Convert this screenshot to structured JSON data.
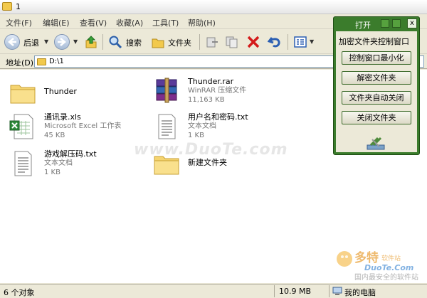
{
  "window": {
    "title": "1"
  },
  "menubar": {
    "items": [
      "文件(F)",
      "编辑(E)",
      "查看(V)",
      "收藏(A)",
      "工具(T)",
      "帮助(H)"
    ]
  },
  "toolbar": {
    "back_label": "后退",
    "search_label": "搜索",
    "folders_label": "文件夹"
  },
  "address": {
    "label": "地址(D)",
    "value": "D:\\1"
  },
  "files": [
    {
      "name": "Thunder",
      "type": "",
      "size": "",
      "icon": "folder-icon"
    },
    {
      "name": "Thunder.rar",
      "type": "WinRAR 压缩文件",
      "size": "11,163 KB",
      "icon": "winrar-archive-icon"
    },
    {
      "name": "通讯录.xls",
      "type": "Microsoft Excel 工作表",
      "size": "45 KB",
      "icon": "excel-file-icon"
    },
    {
      "name": "用户名和密码.txt",
      "type": "文本文档",
      "size": "1 KB",
      "icon": "text-file-icon"
    },
    {
      "name": "游戏解压码.txt",
      "type": "文本文档",
      "size": "1 KB",
      "icon": "text-file-icon"
    },
    {
      "name": "新建文件夹",
      "type": "",
      "size": "",
      "icon": "folder-icon"
    }
  ],
  "watermark": "www.DuoTe.com",
  "logo": {
    "brand": "多特",
    "sub": "软件站",
    "url": "DuoTe.Com",
    "slogan": "国内最安全的软件站"
  },
  "statusbar": {
    "objects": "6 个对象",
    "size": "10.9 MB",
    "location": "我的电脑"
  },
  "panel": {
    "title": "打开",
    "close": "x",
    "heading": "加密文件夹控制窗口",
    "buttons": [
      "控制窗口最小化",
      "解密文件夹",
      "文件夹自动关闭",
      "关闭文件夹"
    ]
  },
  "colors": {
    "panel_green": "#3b7c2c",
    "folder_yellow": "#f2c94c",
    "chrome": "#ece9d8"
  }
}
